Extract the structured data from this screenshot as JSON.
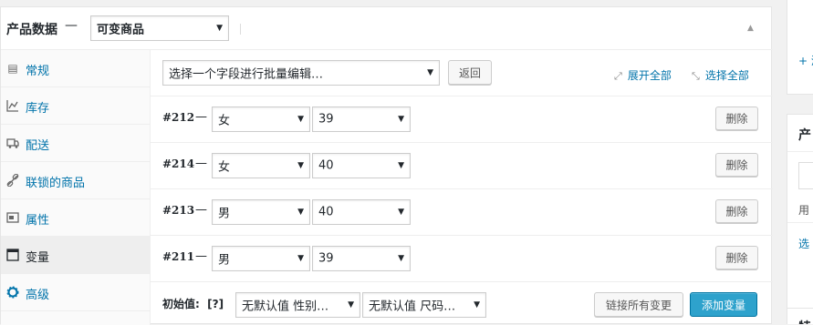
{
  "header": {
    "title": "产品数据",
    "dash": "—",
    "product_type": "可变商品",
    "toggle_icon": "triangle-up-icon"
  },
  "sidebar": {
    "items": [
      {
        "label": "常规",
        "icon": "general-icon"
      },
      {
        "label": "库存",
        "icon": "inventory-icon"
      },
      {
        "label": "配送",
        "icon": "shipping-icon"
      },
      {
        "label": "联锁的商品",
        "icon": "linked-products-icon"
      },
      {
        "label": "属性",
        "icon": "attributes-icon"
      },
      {
        "label": "变量",
        "icon": "variations-icon",
        "active": true
      },
      {
        "label": "高级",
        "icon": "advanced-icon"
      }
    ]
  },
  "toolbar": {
    "bulk_select": "选择一个字段进行批量编辑…",
    "go_button": "返回",
    "expand_all": "展开全部",
    "select_all": "选择全部"
  },
  "variations": [
    {
      "id": "#212",
      "dash": "—",
      "gender": "女",
      "size": "39",
      "remove": "删除"
    },
    {
      "id": "#214",
      "dash": "—",
      "gender": "女",
      "size": "40",
      "remove": "删除"
    },
    {
      "id": "#213",
      "dash": "—",
      "gender": "男",
      "size": "40",
      "remove": "删除"
    },
    {
      "id": "#211",
      "dash": "—",
      "gender": "男",
      "size": "39",
      "remove": "删除"
    }
  ],
  "footer": {
    "defaults_label": "初始值:",
    "help": "[?]",
    "default_gender": "无默认值 性别…",
    "default_size": "无默认值 尺码…",
    "link_all": "链接所有变更",
    "add_variation": "添加变量"
  },
  "right_column": {
    "add_link": "+ 添",
    "box2_title": "产",
    "box2_text": "用",
    "box2_link": "选",
    "box3_title": "特"
  },
  "colors": {
    "link": "#0073aa",
    "primary_button": "#2ea2cc",
    "active_tab_bg": "#eeeeee"
  }
}
